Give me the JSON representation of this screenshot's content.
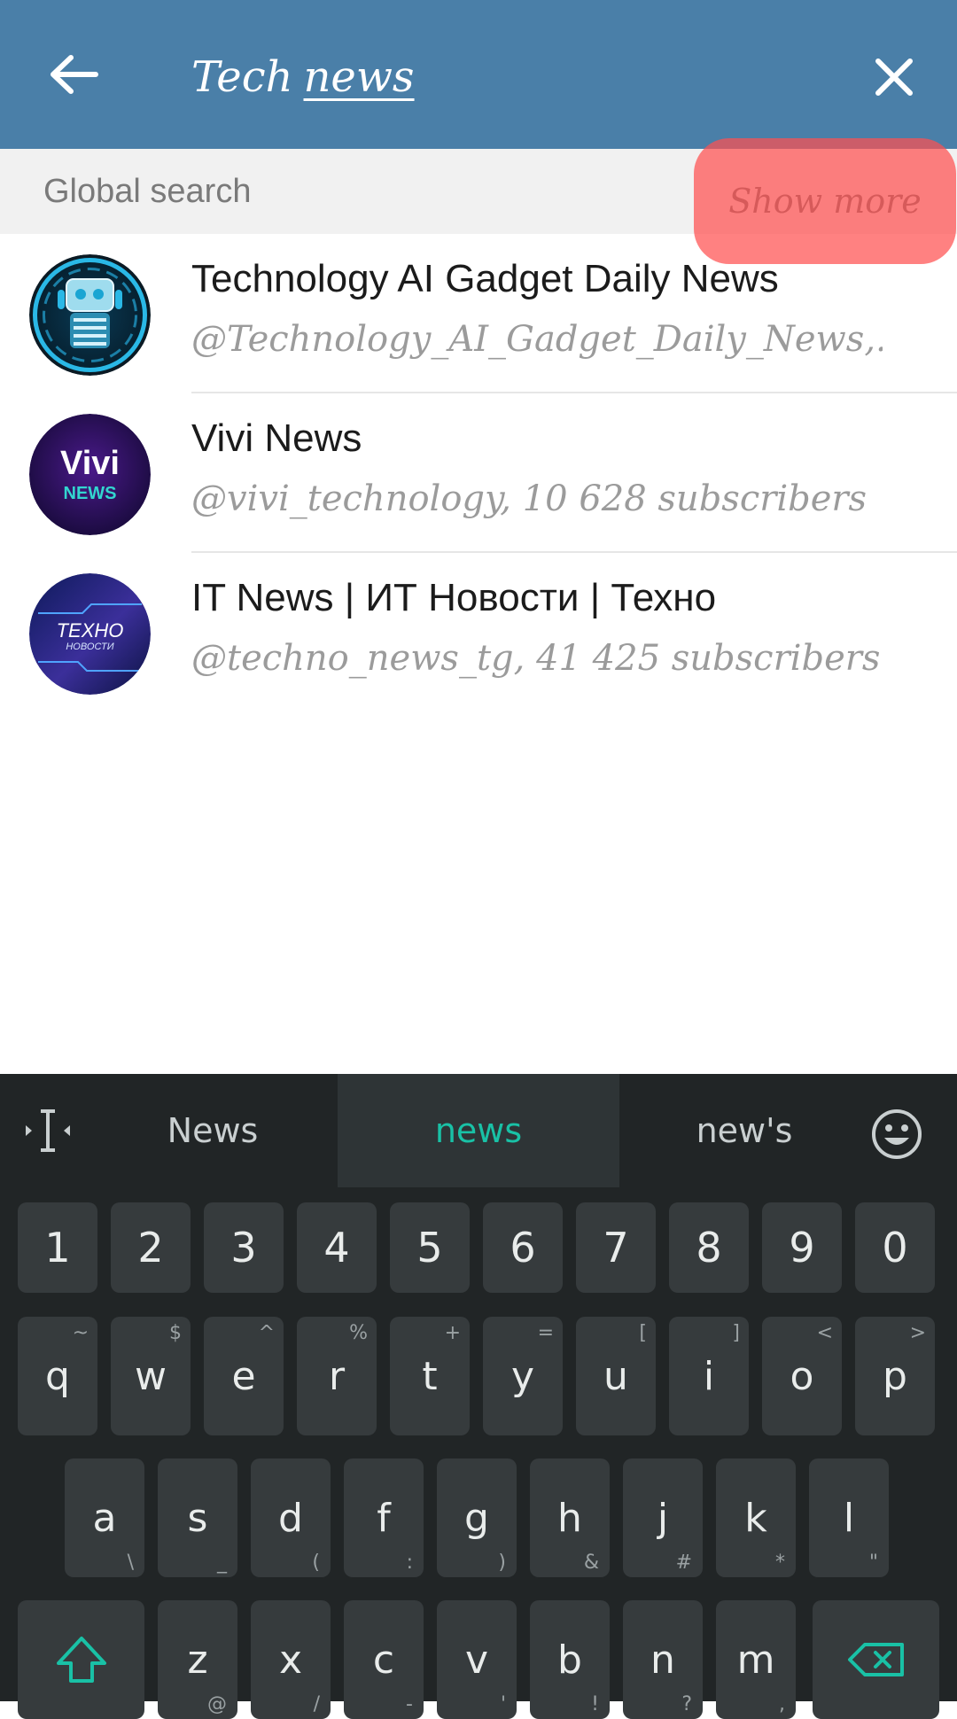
{
  "header": {
    "query_word1": "Tech",
    "query_word2": "news",
    "colors": {
      "bar": "#4a7fa8"
    }
  },
  "global_search": {
    "title": "Global search",
    "show_more": "Show more"
  },
  "results": [
    {
      "title": "Technology AI Gadget Daily News",
      "subtitle": "@Technology_AI_Gadget_Daily_News,..."
    },
    {
      "title": "Vivi News",
      "subtitle": "@vivi_technology, 10 628 subscribers",
      "avatar_text_1": "Vivi",
      "avatar_text_2": "NEWS"
    },
    {
      "title": "IT News | ИТ Новости | Техно",
      "subtitle": "@techno_news_tg, 41 425 subscribers",
      "avatar_text_1": "ТЕХНО",
      "avatar_text_2": "НОВОСТИ"
    }
  ],
  "keyboard": {
    "suggestions": [
      "News",
      "news",
      "new's"
    ],
    "accent": "#19c1a6",
    "row_numbers": [
      "1",
      "2",
      "3",
      "4",
      "5",
      "6",
      "7",
      "8",
      "9",
      "0"
    ],
    "row1": [
      {
        "k": "q",
        "alt": "~"
      },
      {
        "k": "w",
        "alt": "$"
      },
      {
        "k": "e",
        "alt": "^"
      },
      {
        "k": "r",
        "alt": "%"
      },
      {
        "k": "t",
        "alt": "+"
      },
      {
        "k": "y",
        "alt": "="
      },
      {
        "k": "u",
        "alt": "["
      },
      {
        "k": "i",
        "alt": "]"
      },
      {
        "k": "o",
        "alt": "<"
      },
      {
        "k": "p",
        "alt": ">"
      }
    ],
    "row2": [
      {
        "k": "a",
        "alt": "\\"
      },
      {
        "k": "s",
        "alt": "_"
      },
      {
        "k": "d",
        "alt": "("
      },
      {
        "k": "f",
        "alt": ":"
      },
      {
        "k": "g",
        "alt": ")"
      },
      {
        "k": "h",
        "alt": "&"
      },
      {
        "k": "j",
        "alt": "#"
      },
      {
        "k": "k",
        "alt": "*"
      },
      {
        "k": "l",
        "alt": "\""
      }
    ],
    "row3": [
      {
        "k": "z",
        "alt": "@"
      },
      {
        "k": "x",
        "alt": "/"
      },
      {
        "k": "c",
        "alt": "-"
      },
      {
        "k": "v",
        "alt": "'"
      },
      {
        "k": "b",
        "alt": "!"
      },
      {
        "k": "n",
        "alt": "?"
      },
      {
        "k": "m",
        "alt": ","
      }
    ],
    "icons": [
      "text-cursor-icon",
      "emoji-icon",
      "shift-icon",
      "backspace-icon"
    ]
  }
}
